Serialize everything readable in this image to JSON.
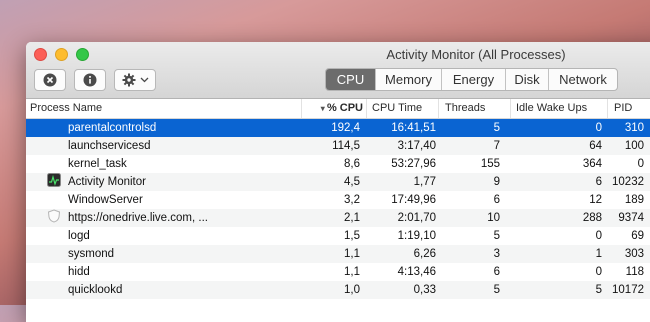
{
  "window": {
    "title": "Activity Monitor (All Processes)"
  },
  "toolbar": {
    "stop_icon": "stop-process-icon",
    "info_icon": "info-icon",
    "gear_icon": "gear-icon",
    "tabs": [
      {
        "label": "CPU",
        "active": true
      },
      {
        "label": "Memory",
        "active": false
      },
      {
        "label": "Energy",
        "active": false
      },
      {
        "label": "Disk",
        "active": false
      },
      {
        "label": "Network",
        "active": false
      }
    ]
  },
  "table": {
    "columns": {
      "name": "Process Name",
      "cpu": "% CPU",
      "cpu_time": "CPU Time",
      "threads": "Threads",
      "idle": "Idle Wake Ups",
      "pid": "PID"
    },
    "sorted_by": "cpu",
    "rows": [
      {
        "name": "parentalcontrolsd",
        "cpu": "192,4",
        "cpu_time": "16:41,51",
        "threads": "5",
        "idle": "0",
        "pid": "310",
        "icon": "",
        "selected": true
      },
      {
        "name": "launchservicesd",
        "cpu": "114,5",
        "cpu_time": "3:17,40",
        "threads": "7",
        "idle": "64",
        "pid": "100",
        "icon": ""
      },
      {
        "name": "kernel_task",
        "cpu": "8,6",
        "cpu_time": "53:27,96",
        "threads": "155",
        "idle": "364",
        "pid": "0",
        "icon": ""
      },
      {
        "name": "Activity Monitor",
        "cpu": "4,5",
        "cpu_time": "1,77",
        "threads": "9",
        "idle": "6",
        "pid": "10232",
        "icon": "activity-monitor-icon"
      },
      {
        "name": "WindowServer",
        "cpu": "3,2",
        "cpu_time": "17:49,96",
        "threads": "6",
        "idle": "12",
        "pid": "189",
        "icon": ""
      },
      {
        "name": "https://onedrive.live.com, ...",
        "cpu": "2,1",
        "cpu_time": "2:01,70",
        "threads": "10",
        "idle": "288",
        "pid": "9374",
        "icon": "shield-icon"
      },
      {
        "name": "logd",
        "cpu": "1,5",
        "cpu_time": "1:19,10",
        "threads": "5",
        "idle": "0",
        "pid": "69",
        "icon": ""
      },
      {
        "name": "sysmond",
        "cpu": "1,1",
        "cpu_time": "6,26",
        "threads": "3",
        "idle": "1",
        "pid": "303",
        "icon": ""
      },
      {
        "name": "hidd",
        "cpu": "1,1",
        "cpu_time": "4:13,46",
        "threads": "6",
        "idle": "0",
        "pid": "118",
        "icon": ""
      },
      {
        "name": "quicklookd",
        "cpu": "1,0",
        "cpu_time": "0,33",
        "threads": "5",
        "idle": "5",
        "pid": "10172",
        "icon": ""
      },
      {
        "name": "",
        "cpu": "",
        "cpu_time": "",
        "threads": "",
        "idle": "",
        "pid": "",
        "icon": ""
      }
    ]
  },
  "colors": {
    "selection": "#0a64d2",
    "active_tab": "#6c6c6c"
  }
}
